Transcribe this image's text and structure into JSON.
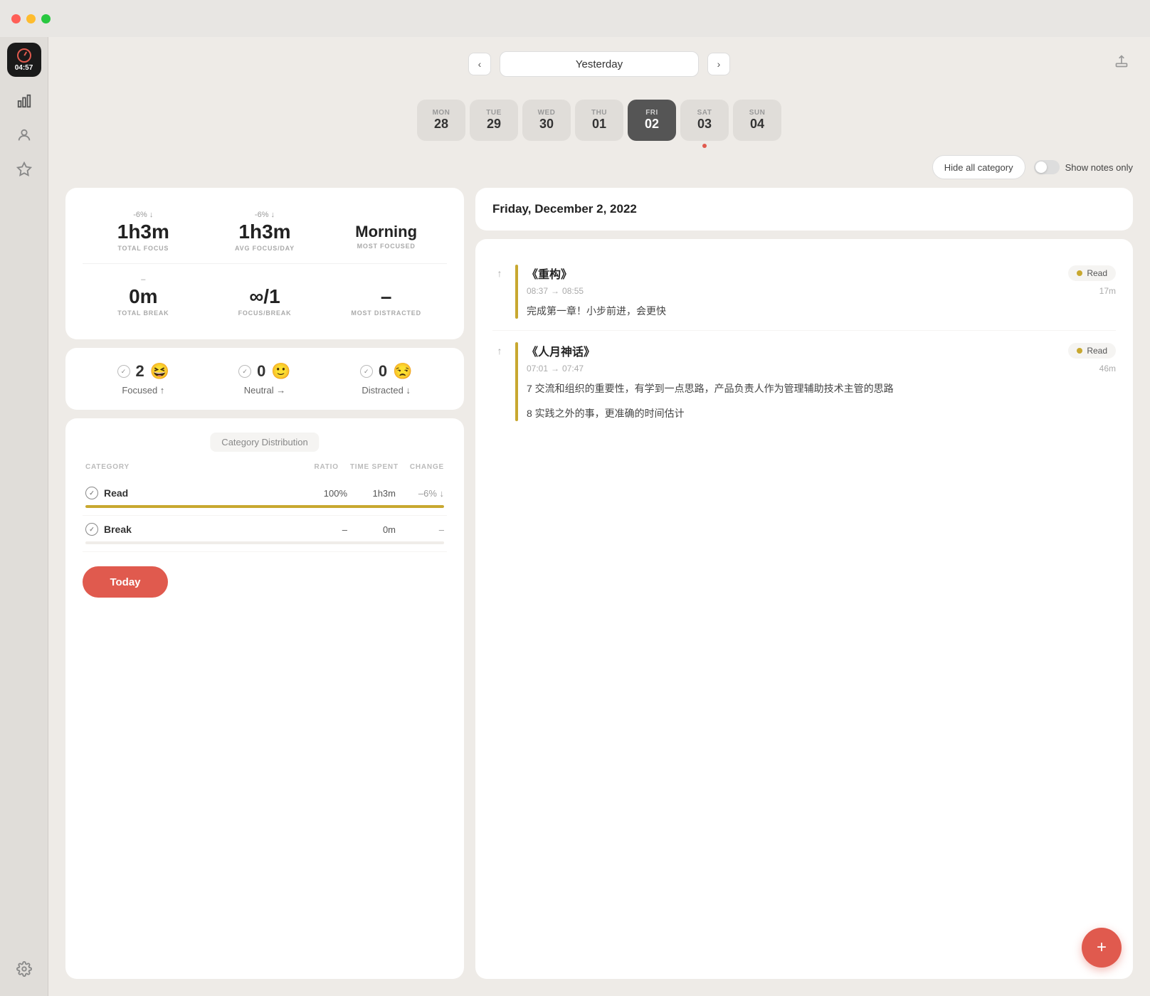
{
  "titlebar": {
    "traffic": [
      "red",
      "yellow",
      "green"
    ]
  },
  "sidebar": {
    "timer_value": "04:57",
    "items": [
      {
        "name": "analytics",
        "label": "Analytics"
      },
      {
        "name": "profile",
        "label": "Profile"
      },
      {
        "name": "favorites",
        "label": "Favorites"
      }
    ],
    "gear_label": "Settings"
  },
  "topnav": {
    "prev_label": "‹",
    "next_label": "›",
    "date_display": "Yesterday",
    "export_label": "⬆",
    "days": [
      {
        "name": "MON",
        "num": "28",
        "active": false,
        "today": false
      },
      {
        "name": "TUE",
        "num": "29",
        "active": false,
        "today": false
      },
      {
        "name": "WED",
        "num": "30",
        "active": false,
        "today": false
      },
      {
        "name": "THU",
        "num": "01",
        "active": false,
        "today": false
      },
      {
        "name": "FRI",
        "num": "02",
        "active": true,
        "today": false
      },
      {
        "name": "SAT",
        "num": "03",
        "active": false,
        "today": true
      },
      {
        "name": "SUN",
        "num": "04",
        "active": false,
        "today": false
      }
    ]
  },
  "filters": {
    "hide_category_label": "Hide all category",
    "show_notes_label": "Show notes only"
  },
  "stats": {
    "total_focus_change": "-6% ↓",
    "total_focus_value": "1h3m",
    "total_focus_label": "TOTAL FOCUS",
    "avg_focus_change": "-6% ↓",
    "avg_focus_value": "1h3m",
    "avg_focus_label": "AVG FOCUS/DAY",
    "most_focused_change": "",
    "most_focused_value": "Morning",
    "most_focused_label": "MOST FOCUSED",
    "total_break_change": "–",
    "total_break_value": "0m",
    "total_break_label": "TOTAL BREAK",
    "focus_break_value": "∞/1",
    "focus_break_label": "FOCUS/BREAK",
    "most_distracted_value": "–",
    "most_distracted_label": "MOST DISTRACTED"
  },
  "moods": [
    {
      "count": "2",
      "emoji": "😆",
      "label": "Focused ↑"
    },
    {
      "count": "0",
      "emoji": "🙂",
      "label": "Neutral →"
    },
    {
      "count": "0",
      "emoji": "😒",
      "label": "Distracted ↓"
    }
  ],
  "category": {
    "title": "Category Distribution",
    "headers": {
      "category": "CATEGORY",
      "ratio": "RATIO",
      "time": "TIME SPENT",
      "change": "CHANGE"
    },
    "rows": [
      {
        "name": "Read",
        "checked": true,
        "ratio": "100%",
        "time": "1h3m",
        "change": "–6% ↓",
        "bar_pct": 100,
        "bar_color": "#c8a830"
      },
      {
        "name": "Break",
        "checked": true,
        "ratio": "–",
        "time": "0m",
        "change": "–",
        "bar_pct": 0,
        "bar_color": "#888"
      }
    ]
  },
  "today_btn": "Today",
  "right_panel": {
    "date_header": "Friday, December 2, 2022",
    "sessions": [
      {
        "title": "《重构》",
        "tag": "Read",
        "time_start": "08:37",
        "time_end": "08:55",
        "duration": "17m",
        "notes": [
          "完成第一章！小步前进，会更快"
        ]
      },
      {
        "title": "《人月神话》",
        "tag": "Read",
        "time_start": "07:01",
        "time_end": "07:47",
        "duration": "46m",
        "notes": [
          "7 交流和组织的重要性，有学到一点思路，产品负责人作为管理辅助技术主管的思路",
          "8 实践之外的事，更准确的时间估计"
        ]
      }
    ]
  },
  "add_btn": "+"
}
